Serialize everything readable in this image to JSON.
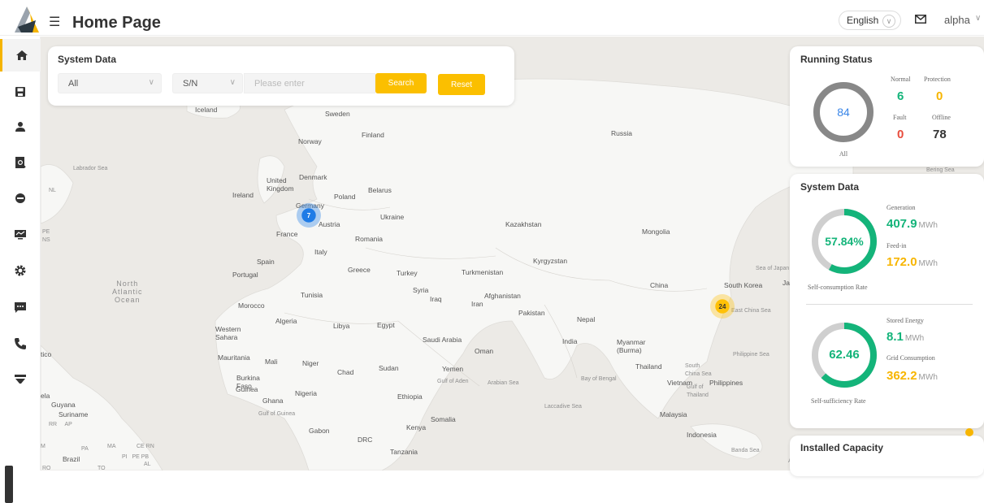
{
  "header": {
    "title": "Home Page",
    "language": "English",
    "user": "alpha",
    "icons": {
      "logo": "app-logo",
      "menu": "menu-toggle-icon",
      "mail": "mail-icon"
    }
  },
  "sidebar": {
    "items": [
      {
        "name": "home",
        "icon": "home-icon",
        "active": true
      },
      {
        "name": "reports",
        "icon": "save-icon"
      },
      {
        "name": "users",
        "icon": "user-icon"
      },
      {
        "name": "search",
        "icon": "search-doc-icon"
      },
      {
        "name": "devices",
        "icon": "device-icon"
      },
      {
        "name": "monitor",
        "icon": "monitor-icon"
      },
      {
        "name": "settings",
        "icon": "gear-icon"
      },
      {
        "name": "messages",
        "icon": "chat-icon"
      },
      {
        "name": "support",
        "icon": "phone-icon"
      },
      {
        "name": "filter",
        "icon": "funnel-icon"
      }
    ]
  },
  "filter": {
    "title": "System Data",
    "scope_value": "All",
    "field_value": "S/N",
    "input_placeholder": "Please enter",
    "search_label": "Search",
    "reset_label": "Reset"
  },
  "map": {
    "labels": [
      {
        "text": "Iceland",
        "cls": ""
      },
      {
        "text": "Sweden",
        "cls": ""
      },
      {
        "text": "Finland",
        "cls": ""
      },
      {
        "text": "Norway",
        "cls": ""
      },
      {
        "text": "Russia",
        "cls": ""
      },
      {
        "text": "Labrador Sea",
        "cls": "sea"
      },
      {
        "text": "Bering Sea",
        "cls": "sea"
      },
      {
        "text": "NL",
        "cls": "sea"
      },
      {
        "text": "Denmark",
        "cls": ""
      },
      {
        "text": "United\nKingdom",
        "cls": ""
      },
      {
        "text": "Ireland",
        "cls": ""
      },
      {
        "text": "Poland",
        "cls": ""
      },
      {
        "text": "Belarus",
        "cls": ""
      },
      {
        "text": "Germany",
        "cls": ""
      },
      {
        "text": "Ukraine",
        "cls": ""
      },
      {
        "text": "Austria",
        "cls": ""
      },
      {
        "text": "France",
        "cls": ""
      },
      {
        "text": "Romania",
        "cls": ""
      },
      {
        "text": "Kazakhstan",
        "cls": ""
      },
      {
        "text": "Mongolia",
        "cls": ""
      },
      {
        "text": "PE\nNS",
        "cls": "sea"
      },
      {
        "text": "Italy",
        "cls": ""
      },
      {
        "text": "Spain",
        "cls": ""
      },
      {
        "text": "Portugal",
        "cls": ""
      },
      {
        "text": "Greece",
        "cls": ""
      },
      {
        "text": "Turkey",
        "cls": ""
      },
      {
        "text": "Turkmenistan",
        "cls": ""
      },
      {
        "text": "Kyrgyzstan",
        "cls": ""
      },
      {
        "text": "Sea of Japan",
        "cls": "sea"
      },
      {
        "text": "China",
        "cls": ""
      },
      {
        "text": "South Korea",
        "cls": ""
      },
      {
        "text": "Ja",
        "cls": ""
      },
      {
        "text": "North\nAtlantic\nOcean",
        "cls": "ocean"
      },
      {
        "text": "Tunisia",
        "cls": ""
      },
      {
        "text": "Syria",
        "cls": ""
      },
      {
        "text": "Iraq",
        "cls": ""
      },
      {
        "text": "Afghanistan",
        "cls": ""
      },
      {
        "text": "Iran",
        "cls": ""
      },
      {
        "text": "Morocco",
        "cls": ""
      },
      {
        "text": "Pakistan",
        "cls": ""
      },
      {
        "text": "Nepal",
        "cls": ""
      },
      {
        "text": "East China Sea",
        "cls": "sea"
      },
      {
        "text": "Algeria",
        "cls": ""
      },
      {
        "text": "Libya",
        "cls": ""
      },
      {
        "text": "Egypt",
        "cls": ""
      },
      {
        "text": "Western\nSahara",
        "cls": ""
      },
      {
        "text": "Saudi Arabia",
        "cls": ""
      },
      {
        "text": "India",
        "cls": ""
      },
      {
        "text": "Myanmar\n(Burma)",
        "cls": ""
      },
      {
        "text": "Oman",
        "cls": ""
      },
      {
        "text": "Philippine Sea",
        "cls": "sea"
      },
      {
        "text": "tico",
        "cls": ""
      },
      {
        "text": "Mauritania",
        "cls": ""
      },
      {
        "text": "Mali",
        "cls": ""
      },
      {
        "text": "Niger",
        "cls": ""
      },
      {
        "text": "Sudan",
        "cls": ""
      },
      {
        "text": "Chad",
        "cls": ""
      },
      {
        "text": "Yemen",
        "cls": ""
      },
      {
        "text": "Thailand",
        "cls": ""
      },
      {
        "text": "South\nChina Sea",
        "cls": "sea"
      },
      {
        "text": "Bay of Bengal",
        "cls": "sea"
      },
      {
        "text": "Gulf of Aden",
        "cls": "sea"
      },
      {
        "text": "Arabian Sea",
        "cls": "sea"
      },
      {
        "text": "Vietnam",
        "cls": ""
      },
      {
        "text": "Philippines",
        "cls": ""
      },
      {
        "text": "Burkina\nFaso",
        "cls": ""
      },
      {
        "text": "Guinea",
        "cls": ""
      },
      {
        "text": "Nigeria",
        "cls": ""
      },
      {
        "text": "Gulf of\nThailand",
        "cls": "sea"
      },
      {
        "text": "ela",
        "cls": ""
      },
      {
        "text": "Guyana",
        "cls": ""
      },
      {
        "text": "Suriname",
        "cls": ""
      },
      {
        "text": "Ghana",
        "cls": ""
      },
      {
        "text": "Ethiopia",
        "cls": ""
      },
      {
        "text": "Laccadive Sea",
        "cls": "sea"
      },
      {
        "text": "Malaysia",
        "cls": ""
      },
      {
        "text": "Gulf of Guinea",
        "cls": "sea"
      },
      {
        "text": "RR     AP",
        "cls": "sea"
      },
      {
        "text": "Somalia",
        "cls": ""
      },
      {
        "text": "Kenya",
        "cls": ""
      },
      {
        "text": "Gabon",
        "cls": ""
      },
      {
        "text": "DRC",
        "cls": ""
      },
      {
        "text": "Indonesia",
        "cls": ""
      },
      {
        "text": "Tanzania",
        "cls": ""
      },
      {
        "text": "Banda Sea",
        "cls": "sea"
      },
      {
        "text": "Arafura S",
        "cls": "sea"
      },
      {
        "text": "M",
        "cls": "sea"
      },
      {
        "text": "PA",
        "cls": "sea"
      },
      {
        "text": "MA",
        "cls": "sea"
      },
      {
        "text": "CE RN",
        "cls": "sea"
      },
      {
        "text": "PI   PE PB",
        "cls": "sea"
      },
      {
        "text": "AL",
        "cls": "sea"
      },
      {
        "text": "Brazil",
        "cls": ""
      },
      {
        "text": "RO",
        "cls": "sea"
      },
      {
        "text": "TO",
        "cls": "sea"
      }
    ],
    "clusters": [
      {
        "count": "7",
        "color": "blue"
      },
      {
        "count": "24",
        "color": "orange"
      }
    ]
  },
  "running_status": {
    "title": "Running Status",
    "total": "84",
    "total_label": "All",
    "normal_label": "Normal",
    "normal_value": "6",
    "protection_label": "Protection",
    "protection_value": "0",
    "fault_label": "Fault",
    "fault_value": "0",
    "offline_label": "Offline",
    "offline_value": "78"
  },
  "system_data": {
    "title": "System Data",
    "self_consumption": {
      "value": "57.84%",
      "fraction": 0.5784,
      "label": "Self-consumption Rate"
    },
    "generation_label": "Generation",
    "generation_value": "407.9",
    "feedin_label": "Feed-in",
    "feedin_value": "172.0",
    "self_sufficiency": {
      "value": "62.46",
      "fraction": 0.6246,
      "label": "Self-sufficiency Rate"
    },
    "stored_label": "Stored Energy",
    "stored_value": "8.1",
    "grid_label": "Grid Consumption",
    "grid_value": "362.2",
    "unit": "MWh"
  },
  "installed_capacity": {
    "title": "Installed Capacity"
  },
  "colors": {
    "accent": "#fbbf00",
    "green": "#14b47a",
    "red": "#e84d3d",
    "blue": "#1e7be6"
  }
}
